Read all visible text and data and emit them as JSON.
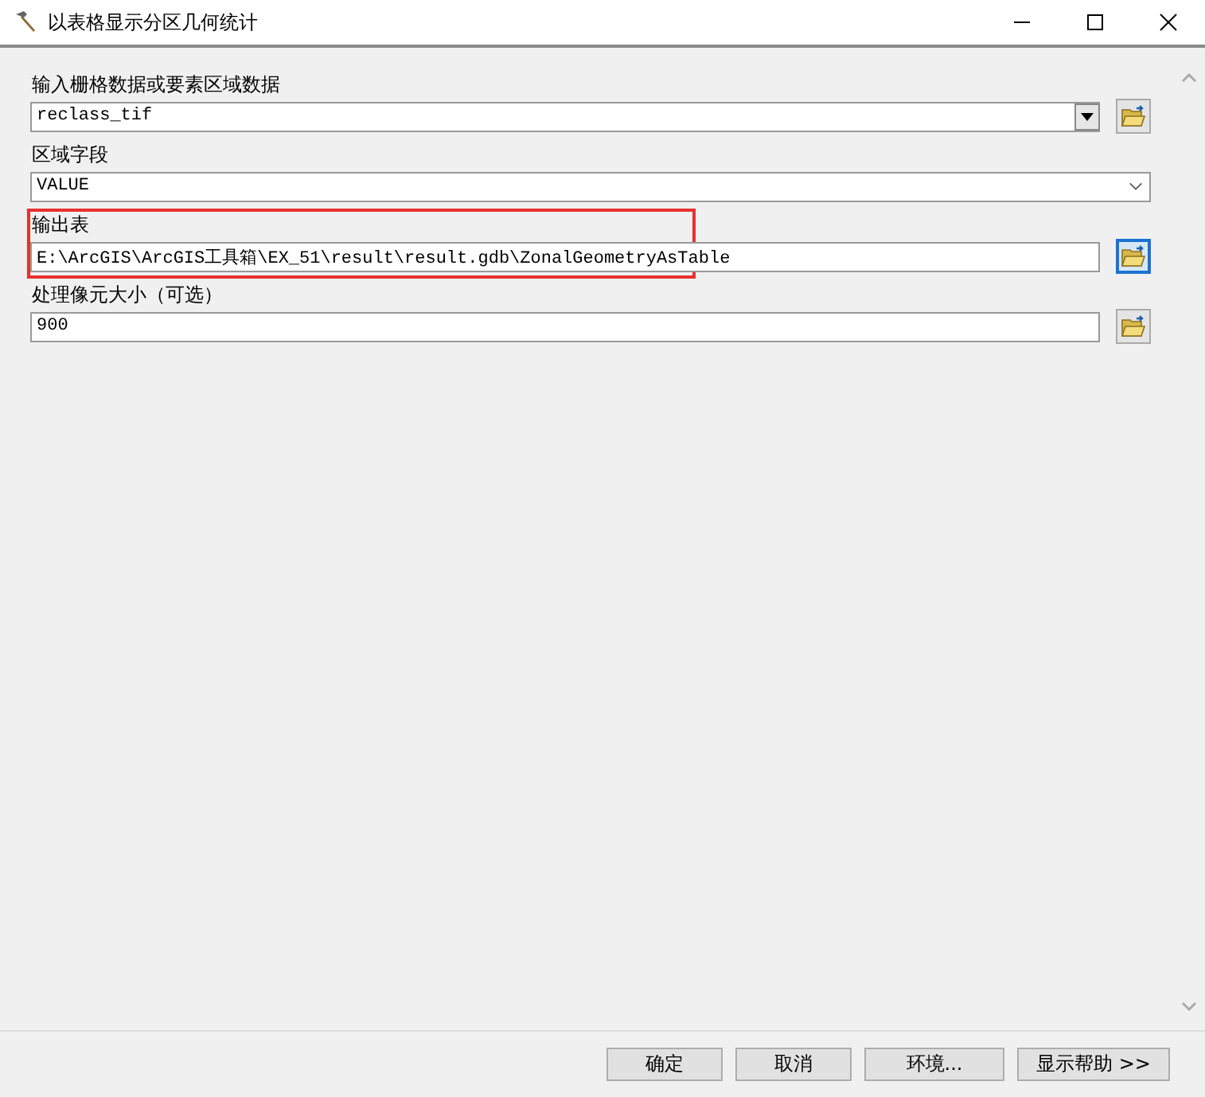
{
  "window": {
    "title": "以表格显示分区几何统计"
  },
  "parameters": [
    {
      "label": "输入栅格数据或要素区域数据",
      "value": "reclass_tif",
      "kind": "combo",
      "browse_button": {
        "focused": false
      },
      "highlighted": false
    },
    {
      "label": "区域字段",
      "value": "VALUE",
      "kind": "select",
      "highlighted": false
    },
    {
      "label": "输出表",
      "value": "E:\\ArcGIS\\ArcGIS工具箱\\EX_51\\result\\result.gdb\\ZonalGeometryAsTable",
      "kind": "text",
      "browse_button": {
        "focused": true
      },
      "highlighted": true
    },
    {
      "label": "处理像元大小（可选）",
      "value": "900",
      "kind": "text",
      "browse_button": {
        "focused": false
      },
      "highlighted": false
    }
  ],
  "buttons": [
    "确定",
    "取消",
    "环境...",
    "显示帮助 >>"
  ]
}
